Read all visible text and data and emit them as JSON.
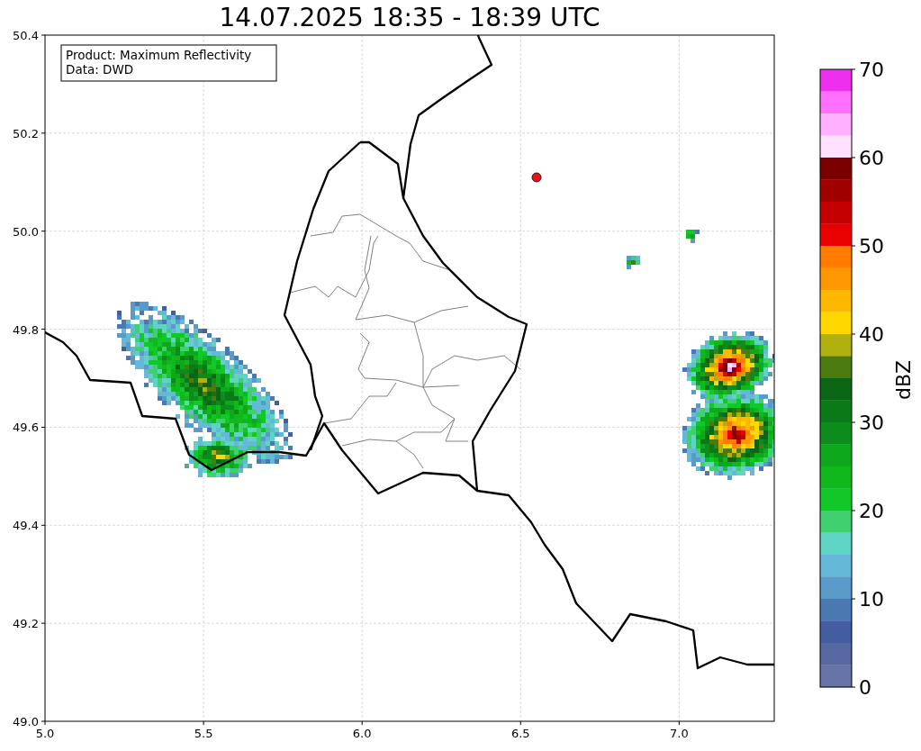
{
  "title": "14.07.2025 18:35 - 18:39 UTC",
  "info_box": {
    "lines": [
      "Product: Maximum Reflectivity",
      "Data: DWD"
    ]
  },
  "map": {
    "x_ticks": [
      "5.0",
      "5.5",
      "6.0",
      "6.5",
      "7.0"
    ],
    "y_ticks": [
      "50.4",
      "50.2",
      "50.0",
      "49.8",
      "49.6",
      "49.4",
      "49.2",
      "49.0"
    ]
  },
  "colorbar": {
    "label": "dBZ",
    "ticks": [
      "70",
      "60",
      "50",
      "40",
      "30",
      "20",
      "10",
      "0"
    ],
    "bins": [
      {
        "color": "#ee30ee"
      },
      {
        "color": "#ff70ff"
      },
      {
        "color": "#ffb0ff"
      },
      {
        "color": "#ffe0ff"
      },
      {
        "color": "#7a0000"
      },
      {
        "color": "#a00000"
      },
      {
        "color": "#c40000"
      },
      {
        "color": "#e80000"
      },
      {
        "color": "#ff7c00"
      },
      {
        "color": "#ff9800"
      },
      {
        "color": "#ffb800"
      },
      {
        "color": "#ffd800"
      },
      {
        "color": "#b0b010"
      },
      {
        "color": "#4a7a10"
      },
      {
        "color": "#0a6614"
      },
      {
        "color": "#0a7a18"
      },
      {
        "color": "#0c8c1a"
      },
      {
        "color": "#0ea81c"
      },
      {
        "color": "#10b81e"
      },
      {
        "color": "#12c828"
      },
      {
        "color": "#40d070"
      },
      {
        "color": "#60d4c4"
      },
      {
        "color": "#66b8d8"
      },
      {
        "color": "#5a9ac8"
      },
      {
        "color": "#4a78b0"
      },
      {
        "color": "#445da0"
      },
      {
        "color": "#5568a0"
      },
      {
        "color": "#6674a8"
      }
    ]
  }
}
